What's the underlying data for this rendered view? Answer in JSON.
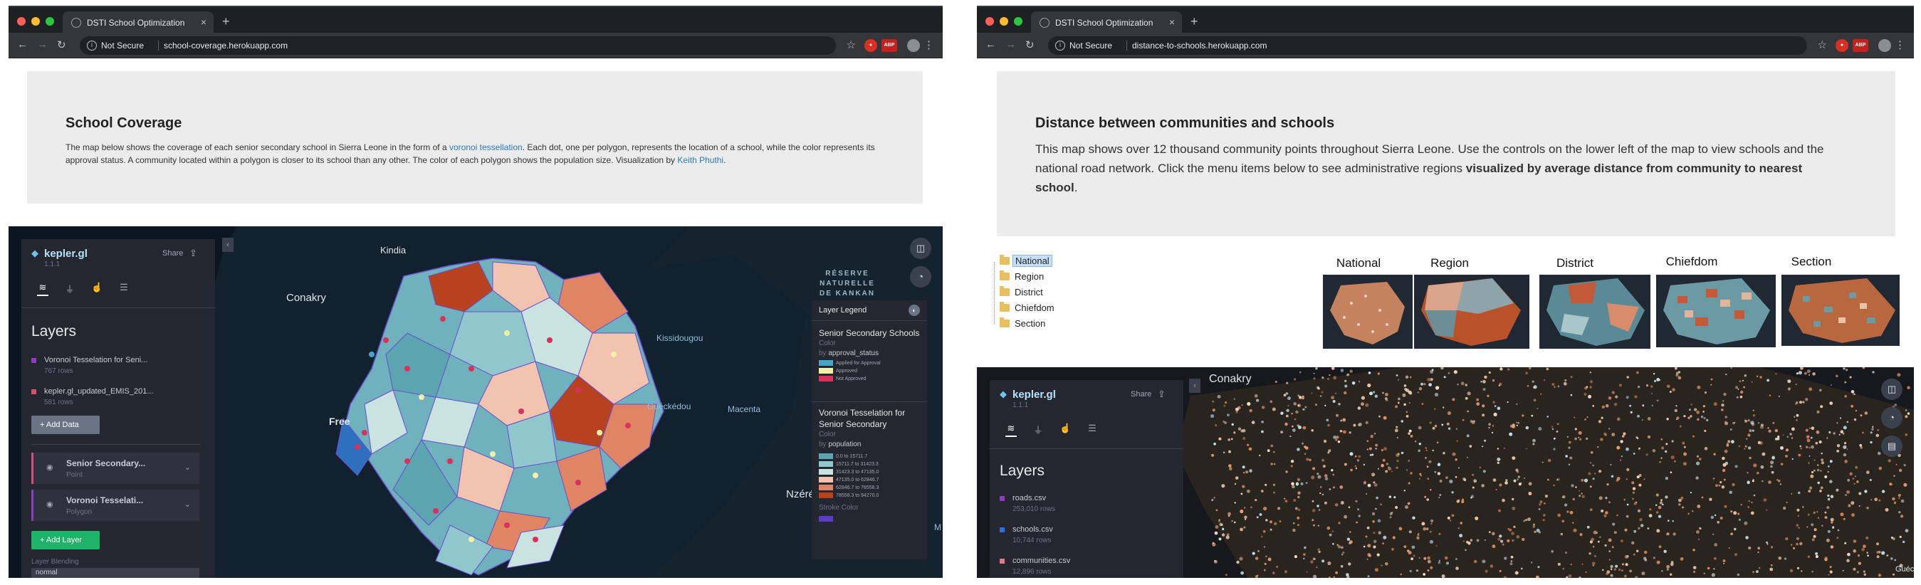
{
  "left_window": {
    "tab_title": "DSTI School Optimization",
    "url_security": "Not Secure",
    "url": "school-coverage.herokuapp.com",
    "page_title": "School Coverage",
    "desc_part1": "The map below shows the coverage of each senior secondary school in Sierra Leone in the form of a ",
    "desc_link1": "voronoi tessellation",
    "desc_part2": ". Each dot, one per polygon, represents the location of a school, while the color represents its approval status. A community located within a polygon is closer to its school than any other. The color of each polygon shows the population size. Visualization by ",
    "desc_link2": "Keith Phuthi",
    "desc_part3": ".",
    "kepler": {
      "brand": "kepler.gl",
      "version": "1.1.1",
      "share": "Share",
      "layers_heading": "Layers",
      "datasets": [
        {
          "name": "Voronoi Tesselation for Seni...",
          "rows": "767 rows",
          "color": "#8b3dbb"
        },
        {
          "name": "kepler.gl_updated_EMIS_201...",
          "rows": "581 rows",
          "color": "#d0507a"
        }
      ],
      "add_data": "Add Data",
      "layer_cards": [
        {
          "name": "Senior Secondary...",
          "type": "Point",
          "color": "#d0507a"
        },
        {
          "name": "Voronoi Tesselati...",
          "type": "Polygon",
          "color": "#8b3dbb"
        }
      ],
      "add_layer": "Add Layer",
      "layer_blending_label": "Layer Blending",
      "layer_blending_value": "normal"
    },
    "places": {
      "kindia": "Kindia",
      "conakry": "Conakry",
      "freetown": "Free",
      "kissidougou": "Kissidougou",
      "gueckedou": "Guéckédou",
      "macenta": "Macenta",
      "nzere": "Nzéré",
      "m": "M"
    },
    "reserve_lines": [
      "RÉSERVE",
      "NATURELLE",
      "DE KANKAN"
    ],
    "legend": {
      "header": "Layer Legend",
      "sec1_title": "Senior Secondary Schools",
      "sec1_color": "Color",
      "sec1_by_prefix": "by",
      "sec1_field": "approval_status",
      "sec1_items": [
        {
          "label": "Applied for Approval",
          "color": "#4aa3c8"
        },
        {
          "label": "Approved",
          "color": "#f4efa8"
        },
        {
          "label": "Not Approved",
          "color": "#d8315b"
        }
      ],
      "sec2_title_1": "Voronoi Tesselation for",
      "sec2_title_2": "Senior Secondary",
      "sec2_color": "Color",
      "sec2_by_prefix": "by",
      "sec2_field": "population",
      "sec2_items": [
        {
          "label": "0.0 to 15711.7",
          "color": "#5ba4b0"
        },
        {
          "label": "15711.7 to 31423.3",
          "color": "#8fc7cc"
        },
        {
          "label": "31423.3 to 47135.0",
          "color": "#c9e3e0"
        },
        {
          "label": "47135.0 to 62846.7",
          "color": "#f2c4b0"
        },
        {
          "label": "62846.7 to 78558.3",
          "color": "#df8564"
        },
        {
          "label": "78558.3 to 94270.0",
          "color": "#b8411f"
        }
      ],
      "stroke_label": "Stroke Color",
      "stroke_color": "#5c3ccf"
    }
  },
  "right_window": {
    "tab_title": "DSTI School Optimization",
    "url_security": "Not Secure",
    "url": "distance-to-schools.herokuapp.com",
    "page_title": "Distance between communities and schools",
    "desc_part1": "This map shows over 12 thousand community points throughout Sierra Leone. Use the controls on the lower left of the map to view schools and the national road network. Click the menu items below to see administrative regions ",
    "desc_bold": "visualized by average distance from community to nearest school",
    "desc_part2": ".",
    "tree_items": [
      "National",
      "Region",
      "District",
      "Chiefdom",
      "Section"
    ],
    "thumbnails": [
      "National",
      "Region",
      "District",
      "Chiefdom",
      "Section"
    ],
    "kepler": {
      "brand": "kepler.gl",
      "version": "1.1.1",
      "share": "Share",
      "layers_heading": "Layers",
      "datasets": [
        {
          "name": "roads.csv",
          "rows": "253,010 rows",
          "color": "#8b3dbb"
        },
        {
          "name": "schools.csv",
          "rows": "10,744 rows",
          "color": "#2c6fd6"
        },
        {
          "name": "communities.csv",
          "rows": "12,896 rows",
          "color": "#d87a8a"
        }
      ]
    },
    "place_conakry": "Conakry",
    "place_guic": "Guéc"
  },
  "chrome": {
    "new_tab_symbol": "+",
    "close_symbol": "×",
    "back": "←",
    "forward": "→",
    "reload": "↻",
    "star": "☆",
    "menu": "⋮",
    "abp": "ABP"
  }
}
